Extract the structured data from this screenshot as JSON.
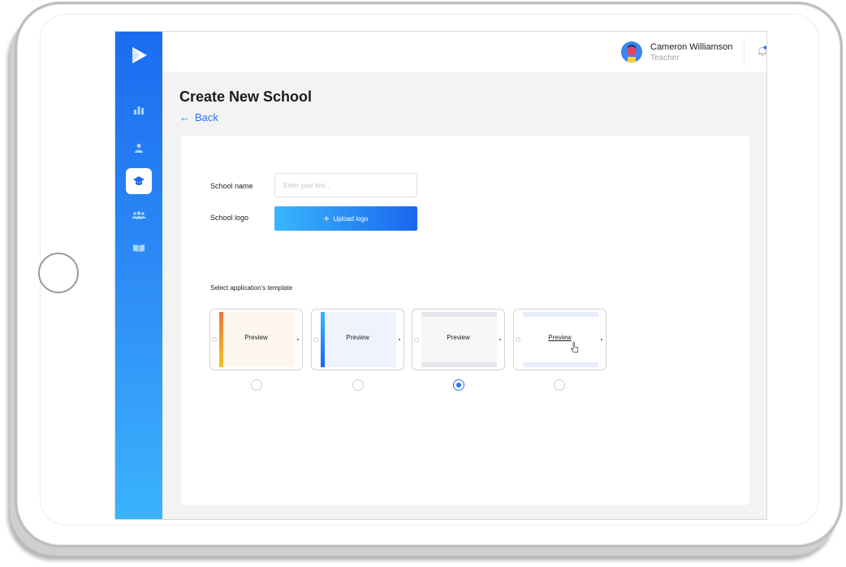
{
  "app": {
    "title": "Create New School",
    "back_label": "Back",
    "back_icon": "arrow-left-icon"
  },
  "user": {
    "name": "Cameron Williamson",
    "role": "Teacher"
  },
  "sidebar": {
    "items": [
      {
        "name": "analytics",
        "icon": "bar-chart-icon",
        "active": false
      },
      {
        "name": "profile",
        "icon": "user-icon",
        "active": false
      },
      {
        "name": "schools",
        "icon": "graduation-cap-icon",
        "active": true
      },
      {
        "name": "groups",
        "icon": "users-icon",
        "active": false
      },
      {
        "name": "library",
        "icon": "book-icon",
        "active": false
      }
    ]
  },
  "form": {
    "school_name_label": "School name",
    "school_name_placeholder": "Enter your text...",
    "school_name_value": "",
    "school_logo_label": "School logo",
    "upload_label": "Upload logo",
    "template_label": "Select application's template"
  },
  "templates": [
    {
      "preview_label": "Preview",
      "accent": "#f08a24",
      "selected": false
    },
    {
      "preview_label": "Preview",
      "accent": "#2f86f4",
      "selected": false
    },
    {
      "preview_label": "Preview",
      "accent": "#e9e9ee",
      "selected": true
    },
    {
      "preview_label": "Preview",
      "accent": "#e8eefb",
      "selected": false
    }
  ],
  "colors": {
    "brand": "#1a6cf0",
    "link": "#2a75f0"
  }
}
